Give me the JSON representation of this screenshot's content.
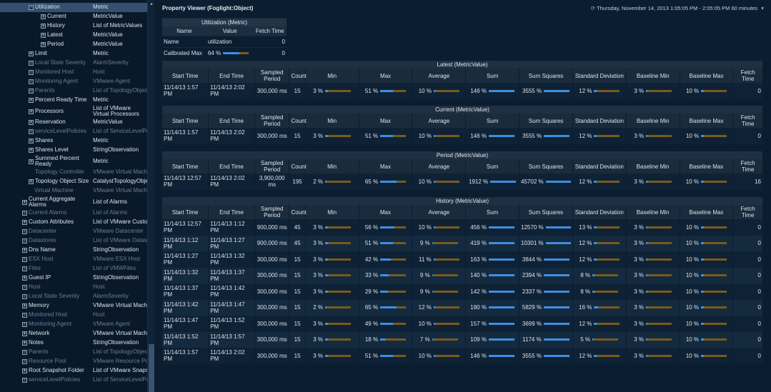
{
  "tree": {
    "rows": [
      {
        "label": "Utilization",
        "value": "Metric",
        "depth": 3,
        "icon": "minus",
        "selected": true,
        "dim": false
      },
      {
        "label": "Current",
        "value": "MetricValue",
        "depth": 4,
        "icon": "plus",
        "dim": false
      },
      {
        "label": "History",
        "value": "List of MetricValues",
        "depth": 4,
        "icon": "plus",
        "dim": false
      },
      {
        "label": "Latest",
        "value": "MetricValue",
        "depth": 4,
        "icon": "plus",
        "dim": false
      },
      {
        "label": "Period",
        "value": "MetricValue",
        "depth": 4,
        "icon": "plus",
        "dim": false
      },
      {
        "label": "Limit",
        "value": "Metric",
        "depth": 3,
        "icon": "plus",
        "dim": false
      },
      {
        "label": "Local State Severity",
        "value": "AlarmSeverity",
        "depth": 3,
        "icon": "plus",
        "dim": true
      },
      {
        "label": "Monitored Host",
        "value": "Host",
        "depth": 3,
        "icon": "plus",
        "dim": true
      },
      {
        "label": "Monitoring Agent",
        "value": "VMware Agent",
        "depth": 3,
        "icon": "plus",
        "dim": true
      },
      {
        "label": "Parents",
        "value": "List of TopologyObjec",
        "depth": 3,
        "icon": "plus",
        "dim": true
      },
      {
        "label": "Percent Ready Time",
        "value": "Metric",
        "depth": 3,
        "icon": "plus",
        "dim": false
      },
      {
        "label": "Processors",
        "value": "List of VMware Virtual Processors",
        "depth": 3,
        "icon": "plus",
        "dim": false,
        "tall": true
      },
      {
        "label": "Reservation",
        "value": "MetricValue",
        "depth": 3,
        "icon": "plus",
        "dim": false
      },
      {
        "label": "serviceLevelPolicies",
        "value": "List of ServiceLevelPo",
        "depth": 3,
        "icon": "plus",
        "dim": true
      },
      {
        "label": "Shares",
        "value": "Metric",
        "depth": 3,
        "icon": "plus",
        "dim": false
      },
      {
        "label": "Shares Level",
        "value": "StringObservation",
        "depth": 3,
        "icon": "plus",
        "dim": false
      },
      {
        "label": "Summed Percent Ready",
        "value": "Metric",
        "depth": 3,
        "icon": "plus",
        "dim": false,
        "tall": true
      },
      {
        "label": "Topology Controller",
        "value": "VMware Virtual Machi",
        "depth": 3,
        "icon": "none",
        "dim": true
      },
      {
        "label": "Topology Object Size",
        "value": "CatalystTopologyObje",
        "depth": 3,
        "icon": "plus",
        "dim": false
      },
      {
        "label": "Virtual Machine",
        "value": "VMware Virtual Machi",
        "depth": 2,
        "icon": "none",
        "dim": true
      },
      {
        "label": "Current Aggregate Alarms",
        "value": "List of Alarms",
        "depth": 1,
        "icon": "plus",
        "dim": false,
        "tall": true
      },
      {
        "label": "Current Alarms",
        "value": "List of Alarms",
        "depth": 1,
        "icon": "plus",
        "dim": true
      },
      {
        "label": "Custom Attributes",
        "value": "List of VMware Custon",
        "depth": 1,
        "icon": "plus",
        "dim": false
      },
      {
        "label": "Datacenter",
        "value": "VMware Datacenter",
        "depth": 1,
        "icon": "plus",
        "dim": true
      },
      {
        "label": "Datastores",
        "value": "List of VMware Datast",
        "depth": 1,
        "icon": "plus",
        "dim": true
      },
      {
        "label": "Dns Name",
        "value": "StringObservation",
        "depth": 1,
        "icon": "plus",
        "dim": false
      },
      {
        "label": "ESX Host",
        "value": "VMware ESX Host",
        "depth": 1,
        "icon": "plus",
        "dim": true
      },
      {
        "label": "Files",
        "value": "List of VMWFiles",
        "depth": 1,
        "icon": "plus",
        "dim": true
      },
      {
        "label": "Guest IP",
        "value": "StringObservation",
        "depth": 1,
        "icon": "plus",
        "dim": false
      },
      {
        "label": "Host",
        "value": "Host",
        "depth": 1,
        "icon": "plus",
        "dim": true
      },
      {
        "label": "Local State Severity",
        "value": "AlarmSeverity",
        "depth": 1,
        "icon": "plus",
        "dim": true
      },
      {
        "label": "Memory",
        "value": "VMware Virtual Machi",
        "depth": 1,
        "icon": "plus",
        "dim": false
      },
      {
        "label": "Monitored Host",
        "value": "Host",
        "depth": 1,
        "icon": "plus",
        "dim": true
      },
      {
        "label": "Monitoring Agent",
        "value": "VMware Agent",
        "depth": 1,
        "icon": "plus",
        "dim": true
      },
      {
        "label": "Network",
        "value": "VMware Virtual Machi",
        "depth": 1,
        "icon": "plus",
        "dim": false
      },
      {
        "label": "Notes",
        "value": "StringObservation",
        "depth": 1,
        "icon": "plus",
        "dim": false
      },
      {
        "label": "Parents",
        "value": "List of TopologyObjec",
        "depth": 1,
        "icon": "plus",
        "dim": true
      },
      {
        "label": "Resource Pool",
        "value": "VMware Resource Poo",
        "depth": 1,
        "icon": "plus",
        "dim": true
      },
      {
        "label": "Root Snapshot Folder",
        "value": "List of VMware Snapsl",
        "depth": 1,
        "icon": "plus",
        "dim": false
      },
      {
        "label": "serviceLevelPolicies",
        "value": "List of ServiceLevelPo",
        "depth": 1,
        "icon": "plus",
        "dim": true
      }
    ]
  },
  "header": {
    "title": "Property Viewer (Foglight:Object)",
    "timerange": "Thursday, November 14, 2013 1:05:05 PM - 2:05:05 PM 60 minutes",
    "clock_icon": "clock-icon",
    "dropdown_icon": "chevron-down-icon"
  },
  "utilization": {
    "caption": "Utilization (Metric)",
    "headers": [
      "Name",
      "Value",
      "Fetch Time"
    ],
    "rows": [
      {
        "name": "Name",
        "value": "utilization",
        "fetch": "0"
      },
      {
        "name": "Calibrated Max",
        "value": "64 %",
        "fetch": "0",
        "bar": 0.64
      }
    ]
  },
  "columns": [
    "Start Time",
    "End Time",
    "Sampled Period",
    "Count",
    "Min",
    "Max",
    "Average",
    "Sum",
    "Sum Squares",
    "Standard Deviation",
    "Baseline Min",
    "Baseline Max",
    "Fetch Time"
  ],
  "colors": {
    "bar_fill": "#3f8fe0",
    "bar_track": "#7a5a1c"
  },
  "sections": [
    {
      "caption": "Latest (MetricValue)",
      "rows": [
        {
          "start": "11/14/13 1:57 PM",
          "end": "11/14/13 2:02 PM",
          "period": "300,000 ms",
          "count": "15",
          "min": "3 %",
          "min_f": 0.1,
          "max": "51 %",
          "max_f": 0.5,
          "avg": "10 %",
          "avg_f": 0.05,
          "sum": "146 %",
          "sum_f": 1,
          "sumsq": "3555 %",
          "sumsq_f": 1,
          "std": "12 %",
          "std_f": 0.1,
          "bmin": "3 %",
          "bmin_f": 0.05,
          "bmax": "10 %",
          "bmax_f": 0.1,
          "fetch": "0"
        }
      ]
    },
    {
      "caption": "Current (MetricValue)",
      "rows": [
        {
          "start": "11/14/13 1:57 PM",
          "end": "11/14/13 2:02 PM",
          "period": "300,000 ms",
          "count": "15",
          "min": "3 %",
          "min_f": 0.1,
          "max": "51 %",
          "max_f": 0.5,
          "avg": "10 %",
          "avg_f": 0.05,
          "sum": "146 %",
          "sum_f": 1,
          "sumsq": "3555 %",
          "sumsq_f": 1,
          "std": "12 %",
          "std_f": 0.1,
          "bmin": "3 %",
          "bmin_f": 0.05,
          "bmax": "10 %",
          "bmax_f": 0.1,
          "fetch": "0"
        }
      ]
    },
    {
      "caption": "Period (MetricValue)",
      "rows": [
        {
          "start": "11/14/13 12:57 PM",
          "end": "11/14/13 2:02 PM",
          "period": "3,900,000 ms",
          "count": "195",
          "min": "2 %",
          "min_f": 0.05,
          "max": "65 %",
          "max_f": 0.65,
          "avg": "10 %",
          "avg_f": 0.05,
          "sum": "1912 %",
          "sum_f": 1,
          "sumsq": "45702 %",
          "sumsq_f": 1,
          "std": "12 %",
          "std_f": 0.1,
          "bmin": "3 %",
          "bmin_f": 0.05,
          "bmax": "10 %",
          "bmax_f": 0.1,
          "fetch": "16"
        }
      ]
    },
    {
      "caption": "History (MetricValue)",
      "rows": [
        {
          "start": "11/14/13 12:57 PM",
          "end": "11/14/13 1:12 PM",
          "period": "900,000 ms",
          "count": "45",
          "min": "3 %",
          "min_f": 0.1,
          "max": "56 %",
          "max_f": 0.56,
          "avg": "10 %",
          "avg_f": 0.05,
          "sum": "456 %",
          "sum_f": 1,
          "sumsq": "12570 %",
          "sumsq_f": 1,
          "std": "13 %",
          "std_f": 0.1,
          "bmin": "3 %",
          "bmin_f": 0.05,
          "bmax": "10 %",
          "bmax_f": 0.1,
          "fetch": "0"
        },
        {
          "start": "11/14/13 1:12 PM",
          "end": "11/14/13 1:27 PM",
          "period": "900,000 ms",
          "count": "45",
          "min": "3 %",
          "min_f": 0.1,
          "max": "51 %",
          "max_f": 0.5,
          "avg": "9 %",
          "avg_f": 0.05,
          "sum": "419 %",
          "sum_f": 1,
          "sumsq": "10301 %",
          "sumsq_f": 1,
          "std": "12 %",
          "std_f": 0.1,
          "bmin": "3 %",
          "bmin_f": 0.05,
          "bmax": "10 %",
          "bmax_f": 0.1,
          "fetch": "0"
        },
        {
          "start": "11/14/13 1:27 PM",
          "end": "11/14/13 1:32 PM",
          "period": "300,000 ms",
          "count": "15",
          "min": "3 %",
          "min_f": 0.1,
          "max": "42 %",
          "max_f": 0.42,
          "avg": "11 %",
          "avg_f": 0.06,
          "sum": "163 %",
          "sum_f": 1,
          "sumsq": "3844 %",
          "sumsq_f": 1,
          "std": "12 %",
          "std_f": 0.1,
          "bmin": "3 %",
          "bmin_f": 0.05,
          "bmax": "10 %",
          "bmax_f": 0.1,
          "fetch": "0"
        },
        {
          "start": "11/14/13 1:32 PM",
          "end": "11/14/13 1:37 PM",
          "period": "300,000 ms",
          "count": "15",
          "min": "3 %",
          "min_f": 0.1,
          "max": "33 %",
          "max_f": 0.33,
          "avg": "9 %",
          "avg_f": 0.05,
          "sum": "140 %",
          "sum_f": 1,
          "sumsq": "2394 %",
          "sumsq_f": 1,
          "std": "8 %",
          "std_f": 0.08,
          "bmin": "3 %",
          "bmin_f": 0.05,
          "bmax": "10 %",
          "bmax_f": 0.1,
          "fetch": "0"
        },
        {
          "start": "11/14/13 1:37 PM",
          "end": "11/14/13 1:42 PM",
          "period": "300,000 ms",
          "count": "15",
          "min": "3 %",
          "min_f": 0.1,
          "max": "29 %",
          "max_f": 0.29,
          "avg": "9 %",
          "avg_f": 0.05,
          "sum": "142 %",
          "sum_f": 1,
          "sumsq": "2337 %",
          "sumsq_f": 1,
          "std": "8 %",
          "std_f": 0.08,
          "bmin": "3 %",
          "bmin_f": 0.05,
          "bmax": "10 %",
          "bmax_f": 0.1,
          "fetch": "0"
        },
        {
          "start": "11/14/13 1:42 PM",
          "end": "11/14/13 1:47 PM",
          "period": "300,000 ms",
          "count": "15",
          "min": "2 %",
          "min_f": 0.05,
          "max": "65 %",
          "max_f": 0.65,
          "avg": "12 %",
          "avg_f": 0.06,
          "sum": "180 %",
          "sum_f": 1,
          "sumsq": "5829 %",
          "sumsq_f": 1,
          "std": "16 %",
          "std_f": 0.16,
          "bmin": "3 %",
          "bmin_f": 0.05,
          "bmax": "10 %",
          "bmax_f": 0.1,
          "fetch": "0"
        },
        {
          "start": "11/14/13 1:47 PM",
          "end": "11/14/13 1:52 PM",
          "period": "300,000 ms",
          "count": "15",
          "min": "3 %",
          "min_f": 0.1,
          "max": "49 %",
          "max_f": 0.49,
          "avg": "10 %",
          "avg_f": 0.05,
          "sum": "157 %",
          "sum_f": 1,
          "sumsq": "3699 %",
          "sumsq_f": 1,
          "std": "12 %",
          "std_f": 0.1,
          "bmin": "3 %",
          "bmin_f": 0.05,
          "bmax": "10 %",
          "bmax_f": 0.1,
          "fetch": "0"
        },
        {
          "start": "11/14/13 1:52 PM",
          "end": "11/14/13 1:57 PM",
          "period": "300,000 ms",
          "count": "15",
          "min": "3 %",
          "min_f": 0.1,
          "max": "18 %",
          "max_f": 0.18,
          "avg": "7 %",
          "avg_f": 0.04,
          "sum": "109 %",
          "sum_f": 1,
          "sumsq": "1174 %",
          "sumsq_f": 1,
          "std": "5 %",
          "std_f": 0.05,
          "bmin": "3 %",
          "bmin_f": 0.05,
          "bmax": "10 %",
          "bmax_f": 0.1,
          "fetch": "0"
        },
        {
          "start": "11/14/13 1:57 PM",
          "end": "11/14/13 2:02 PM",
          "period": "300,000 ms",
          "count": "15",
          "min": "3 %",
          "min_f": 0.1,
          "max": "51 %",
          "max_f": 0.5,
          "avg": "10 %",
          "avg_f": 0.05,
          "sum": "146 %",
          "sum_f": 1,
          "sumsq": "3555 %",
          "sumsq_f": 1,
          "std": "12 %",
          "std_f": 0.1,
          "bmin": "3 %",
          "bmin_f": 0.05,
          "bmax": "10 %",
          "bmax_f": 0.1,
          "fetch": "0"
        }
      ]
    }
  ]
}
